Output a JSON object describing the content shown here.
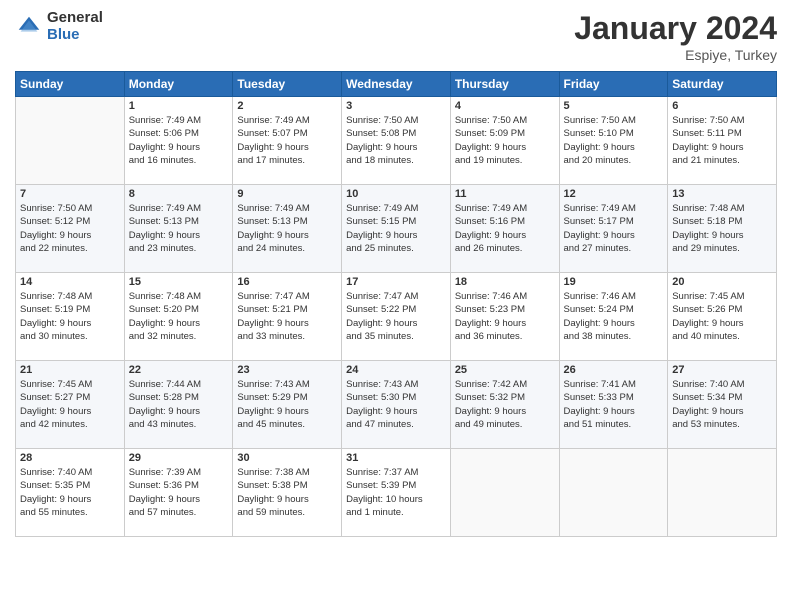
{
  "header": {
    "logo_general": "General",
    "logo_blue": "Blue",
    "month_title": "January 2024",
    "location": "Espiye, Turkey"
  },
  "weekdays": [
    "Sunday",
    "Monday",
    "Tuesday",
    "Wednesday",
    "Thursday",
    "Friday",
    "Saturday"
  ],
  "weeks": [
    [
      {
        "day": "",
        "lines": []
      },
      {
        "day": "1",
        "lines": [
          "Sunrise: 7:49 AM",
          "Sunset: 5:06 PM",
          "Daylight: 9 hours",
          "and 16 minutes."
        ]
      },
      {
        "day": "2",
        "lines": [
          "Sunrise: 7:49 AM",
          "Sunset: 5:07 PM",
          "Daylight: 9 hours",
          "and 17 minutes."
        ]
      },
      {
        "day": "3",
        "lines": [
          "Sunrise: 7:50 AM",
          "Sunset: 5:08 PM",
          "Daylight: 9 hours",
          "and 18 minutes."
        ]
      },
      {
        "day": "4",
        "lines": [
          "Sunrise: 7:50 AM",
          "Sunset: 5:09 PM",
          "Daylight: 9 hours",
          "and 19 minutes."
        ]
      },
      {
        "day": "5",
        "lines": [
          "Sunrise: 7:50 AM",
          "Sunset: 5:10 PM",
          "Daylight: 9 hours",
          "and 20 minutes."
        ]
      },
      {
        "day": "6",
        "lines": [
          "Sunrise: 7:50 AM",
          "Sunset: 5:11 PM",
          "Daylight: 9 hours",
          "and 21 minutes."
        ]
      }
    ],
    [
      {
        "day": "7",
        "lines": [
          "Sunrise: 7:50 AM",
          "Sunset: 5:12 PM",
          "Daylight: 9 hours",
          "and 22 minutes."
        ]
      },
      {
        "day": "8",
        "lines": [
          "Sunrise: 7:49 AM",
          "Sunset: 5:13 PM",
          "Daylight: 9 hours",
          "and 23 minutes."
        ]
      },
      {
        "day": "9",
        "lines": [
          "Sunrise: 7:49 AM",
          "Sunset: 5:13 PM",
          "Daylight: 9 hours",
          "and 24 minutes."
        ]
      },
      {
        "day": "10",
        "lines": [
          "Sunrise: 7:49 AM",
          "Sunset: 5:15 PM",
          "Daylight: 9 hours",
          "and 25 minutes."
        ]
      },
      {
        "day": "11",
        "lines": [
          "Sunrise: 7:49 AM",
          "Sunset: 5:16 PM",
          "Daylight: 9 hours",
          "and 26 minutes."
        ]
      },
      {
        "day": "12",
        "lines": [
          "Sunrise: 7:49 AM",
          "Sunset: 5:17 PM",
          "Daylight: 9 hours",
          "and 27 minutes."
        ]
      },
      {
        "day": "13",
        "lines": [
          "Sunrise: 7:48 AM",
          "Sunset: 5:18 PM",
          "Daylight: 9 hours",
          "and 29 minutes."
        ]
      }
    ],
    [
      {
        "day": "14",
        "lines": [
          "Sunrise: 7:48 AM",
          "Sunset: 5:19 PM",
          "Daylight: 9 hours",
          "and 30 minutes."
        ]
      },
      {
        "day": "15",
        "lines": [
          "Sunrise: 7:48 AM",
          "Sunset: 5:20 PM",
          "Daylight: 9 hours",
          "and 32 minutes."
        ]
      },
      {
        "day": "16",
        "lines": [
          "Sunrise: 7:47 AM",
          "Sunset: 5:21 PM",
          "Daylight: 9 hours",
          "and 33 minutes."
        ]
      },
      {
        "day": "17",
        "lines": [
          "Sunrise: 7:47 AM",
          "Sunset: 5:22 PM",
          "Daylight: 9 hours",
          "and 35 minutes."
        ]
      },
      {
        "day": "18",
        "lines": [
          "Sunrise: 7:46 AM",
          "Sunset: 5:23 PM",
          "Daylight: 9 hours",
          "and 36 minutes."
        ]
      },
      {
        "day": "19",
        "lines": [
          "Sunrise: 7:46 AM",
          "Sunset: 5:24 PM",
          "Daylight: 9 hours",
          "and 38 minutes."
        ]
      },
      {
        "day": "20",
        "lines": [
          "Sunrise: 7:45 AM",
          "Sunset: 5:26 PM",
          "Daylight: 9 hours",
          "and 40 minutes."
        ]
      }
    ],
    [
      {
        "day": "21",
        "lines": [
          "Sunrise: 7:45 AM",
          "Sunset: 5:27 PM",
          "Daylight: 9 hours",
          "and 42 minutes."
        ]
      },
      {
        "day": "22",
        "lines": [
          "Sunrise: 7:44 AM",
          "Sunset: 5:28 PM",
          "Daylight: 9 hours",
          "and 43 minutes."
        ]
      },
      {
        "day": "23",
        "lines": [
          "Sunrise: 7:43 AM",
          "Sunset: 5:29 PM",
          "Daylight: 9 hours",
          "and 45 minutes."
        ]
      },
      {
        "day": "24",
        "lines": [
          "Sunrise: 7:43 AM",
          "Sunset: 5:30 PM",
          "Daylight: 9 hours",
          "and 47 minutes."
        ]
      },
      {
        "day": "25",
        "lines": [
          "Sunrise: 7:42 AM",
          "Sunset: 5:32 PM",
          "Daylight: 9 hours",
          "and 49 minutes."
        ]
      },
      {
        "day": "26",
        "lines": [
          "Sunrise: 7:41 AM",
          "Sunset: 5:33 PM",
          "Daylight: 9 hours",
          "and 51 minutes."
        ]
      },
      {
        "day": "27",
        "lines": [
          "Sunrise: 7:40 AM",
          "Sunset: 5:34 PM",
          "Daylight: 9 hours",
          "and 53 minutes."
        ]
      }
    ],
    [
      {
        "day": "28",
        "lines": [
          "Sunrise: 7:40 AM",
          "Sunset: 5:35 PM",
          "Daylight: 9 hours",
          "and 55 minutes."
        ]
      },
      {
        "day": "29",
        "lines": [
          "Sunrise: 7:39 AM",
          "Sunset: 5:36 PM",
          "Daylight: 9 hours",
          "and 57 minutes."
        ]
      },
      {
        "day": "30",
        "lines": [
          "Sunrise: 7:38 AM",
          "Sunset: 5:38 PM",
          "Daylight: 9 hours",
          "and 59 minutes."
        ]
      },
      {
        "day": "31",
        "lines": [
          "Sunrise: 7:37 AM",
          "Sunset: 5:39 PM",
          "Daylight: 10 hours",
          "and 1 minute."
        ]
      },
      {
        "day": "",
        "lines": []
      },
      {
        "day": "",
        "lines": []
      },
      {
        "day": "",
        "lines": []
      }
    ]
  ]
}
